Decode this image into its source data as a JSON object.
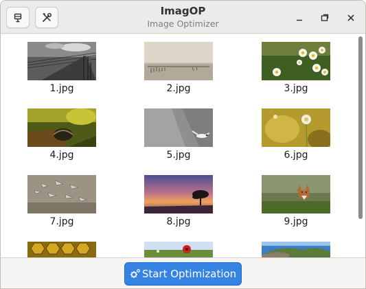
{
  "window": {
    "title": "ImagOP",
    "subtitle": "Image Optimizer"
  },
  "headerbar": {
    "left_buttons": [
      {
        "name": "open-menu-button",
        "icon": "save-icon"
      },
      {
        "name": "tools-button",
        "icon": "tools-icon"
      }
    ],
    "window_controls": [
      "minimize-icon",
      "maximize-icon",
      "close-icon"
    ]
  },
  "images": [
    {
      "filename": "1.jpg",
      "scene": "power-lines"
    },
    {
      "filename": "2.jpg",
      "scene": "foggy-lake"
    },
    {
      "filename": "3.jpg",
      "scene": "daisies"
    },
    {
      "filename": "4.jpg",
      "scene": "forest-bridge"
    },
    {
      "filename": "5.jpg",
      "scene": "gull"
    },
    {
      "filename": "6.jpg",
      "scene": "dandelion"
    },
    {
      "filename": "7.jpg",
      "scene": "flying-geese"
    },
    {
      "filename": "8.jpg",
      "scene": "sunset-tree"
    },
    {
      "filename": "9.jpg",
      "scene": "fox"
    },
    {
      "filename": "",
      "scene": "honeycomb"
    },
    {
      "filename": "",
      "scene": "poppy"
    },
    {
      "filename": "",
      "scene": "coastal-rocks"
    }
  ],
  "actions": {
    "start_label": "Start Optimization",
    "start_icon": "gear-icon"
  },
  "colors": {
    "accent": "#3584e4",
    "headerbar": "#ebebea",
    "content_bg": "#ffffff"
  }
}
